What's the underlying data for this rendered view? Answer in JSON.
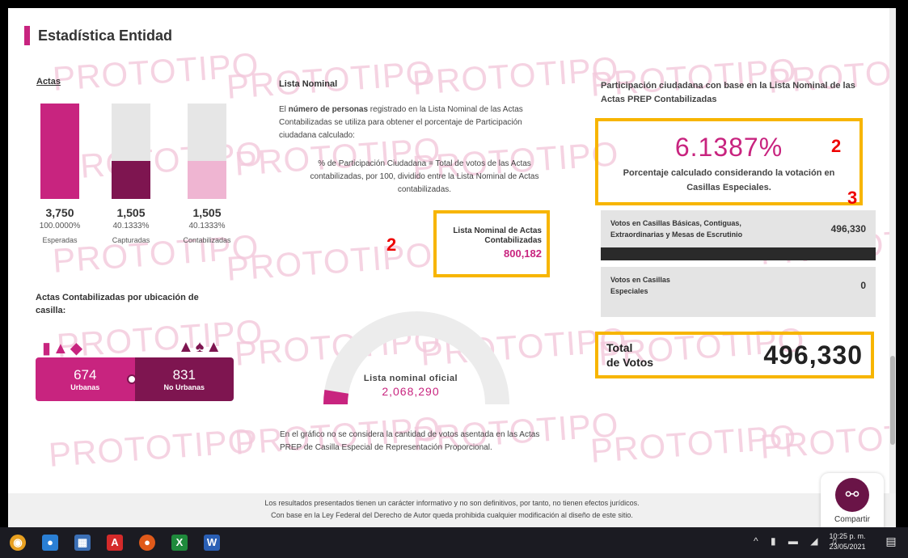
{
  "section": {
    "title": "Estadística Entidad"
  },
  "watermark_text": "PROTOTIPO",
  "actas": {
    "label": "Actas",
    "items": [
      {
        "value": "3,750",
        "percent": "100.0000%",
        "caption": "Esperadas",
        "fill_fraction": 1.0,
        "color": "#c8247f"
      },
      {
        "value": "1,505",
        "percent": "40.1333%",
        "caption": "Capturadas",
        "fill_fraction": 0.4,
        "color": "#7e1550"
      },
      {
        "value": "1,505",
        "percent": "40.1333%",
        "caption": "Contabilizadas",
        "fill_fraction": 0.4,
        "color": "#efb5d2"
      }
    ]
  },
  "ubicacion": {
    "title": "Actas Contabilizadas por ubicación de casilla:",
    "urbanas": {
      "value": "674",
      "label": "Urbanas"
    },
    "no_urbanas": {
      "value": "831",
      "label": "No Urbanas"
    }
  },
  "lista_nominal": {
    "title": "Lista Nominal",
    "desc_prefix": "El ",
    "desc_bold": "número de personas",
    "desc_rest": " registrado en la Lista Nominal de las Actas Contabilizadas se utiliza para obtener el porcentaje de Participación ciudadana calculado:",
    "formula": "% de Participación Ciudadana = Total de votos de las Actas contabilizadas, por 100, dividido entre la Lista Nominal de Actas contabilizadas.",
    "box_title": "Lista Nominal de Actas Contabilizadas",
    "box_value": "800,182"
  },
  "gauge": {
    "label": "Lista nominal oficial",
    "value": "2,068,290",
    "fill_fraction": 0.05,
    "note": "En el gráfico no se considera la cantidad de votos asentada en las Actas PREP de Casilla Especial de Representación Proporcional."
  },
  "participacion": {
    "title": "Participación ciudadana con base en la Lista Nominal de las Actas PREP Contabilizadas",
    "percent": "6.1387%",
    "desc": "Porcentaje calculado considerando la votación en Casillas Especiales."
  },
  "votes": {
    "basicas_label": "Votos en Casillas Básicas, Contiguas, Extraordinarias y Mesas de Escrutinio",
    "basicas_value": "496,330",
    "especiales_label": "Votos en Casillas Especiales",
    "especiales_value": "0"
  },
  "total": {
    "label_line1": "Total",
    "label_line2": "de Votos",
    "value": "496,330"
  },
  "annotations": {
    "m1": "2",
    "m2": "2",
    "m3": "3"
  },
  "footer": {
    "line1": "Los resultados presentados tienen un carácter informativo y no son definitivos, por tanto, no tienen efectos jurídicos.",
    "line2": "Con base en la Ley Federal del Derecho de Autor queda prohibida cualquier modificación al diseño de este sitio."
  },
  "share": {
    "label": "Compartir"
  },
  "taskbar": {
    "time": "10:25 p. m.",
    "date": "23/05/2021"
  },
  "colors": {
    "primary": "#c8247f",
    "dark": "#7e1550",
    "light": "#efb5d2",
    "highlight": "#f7b500"
  }
}
